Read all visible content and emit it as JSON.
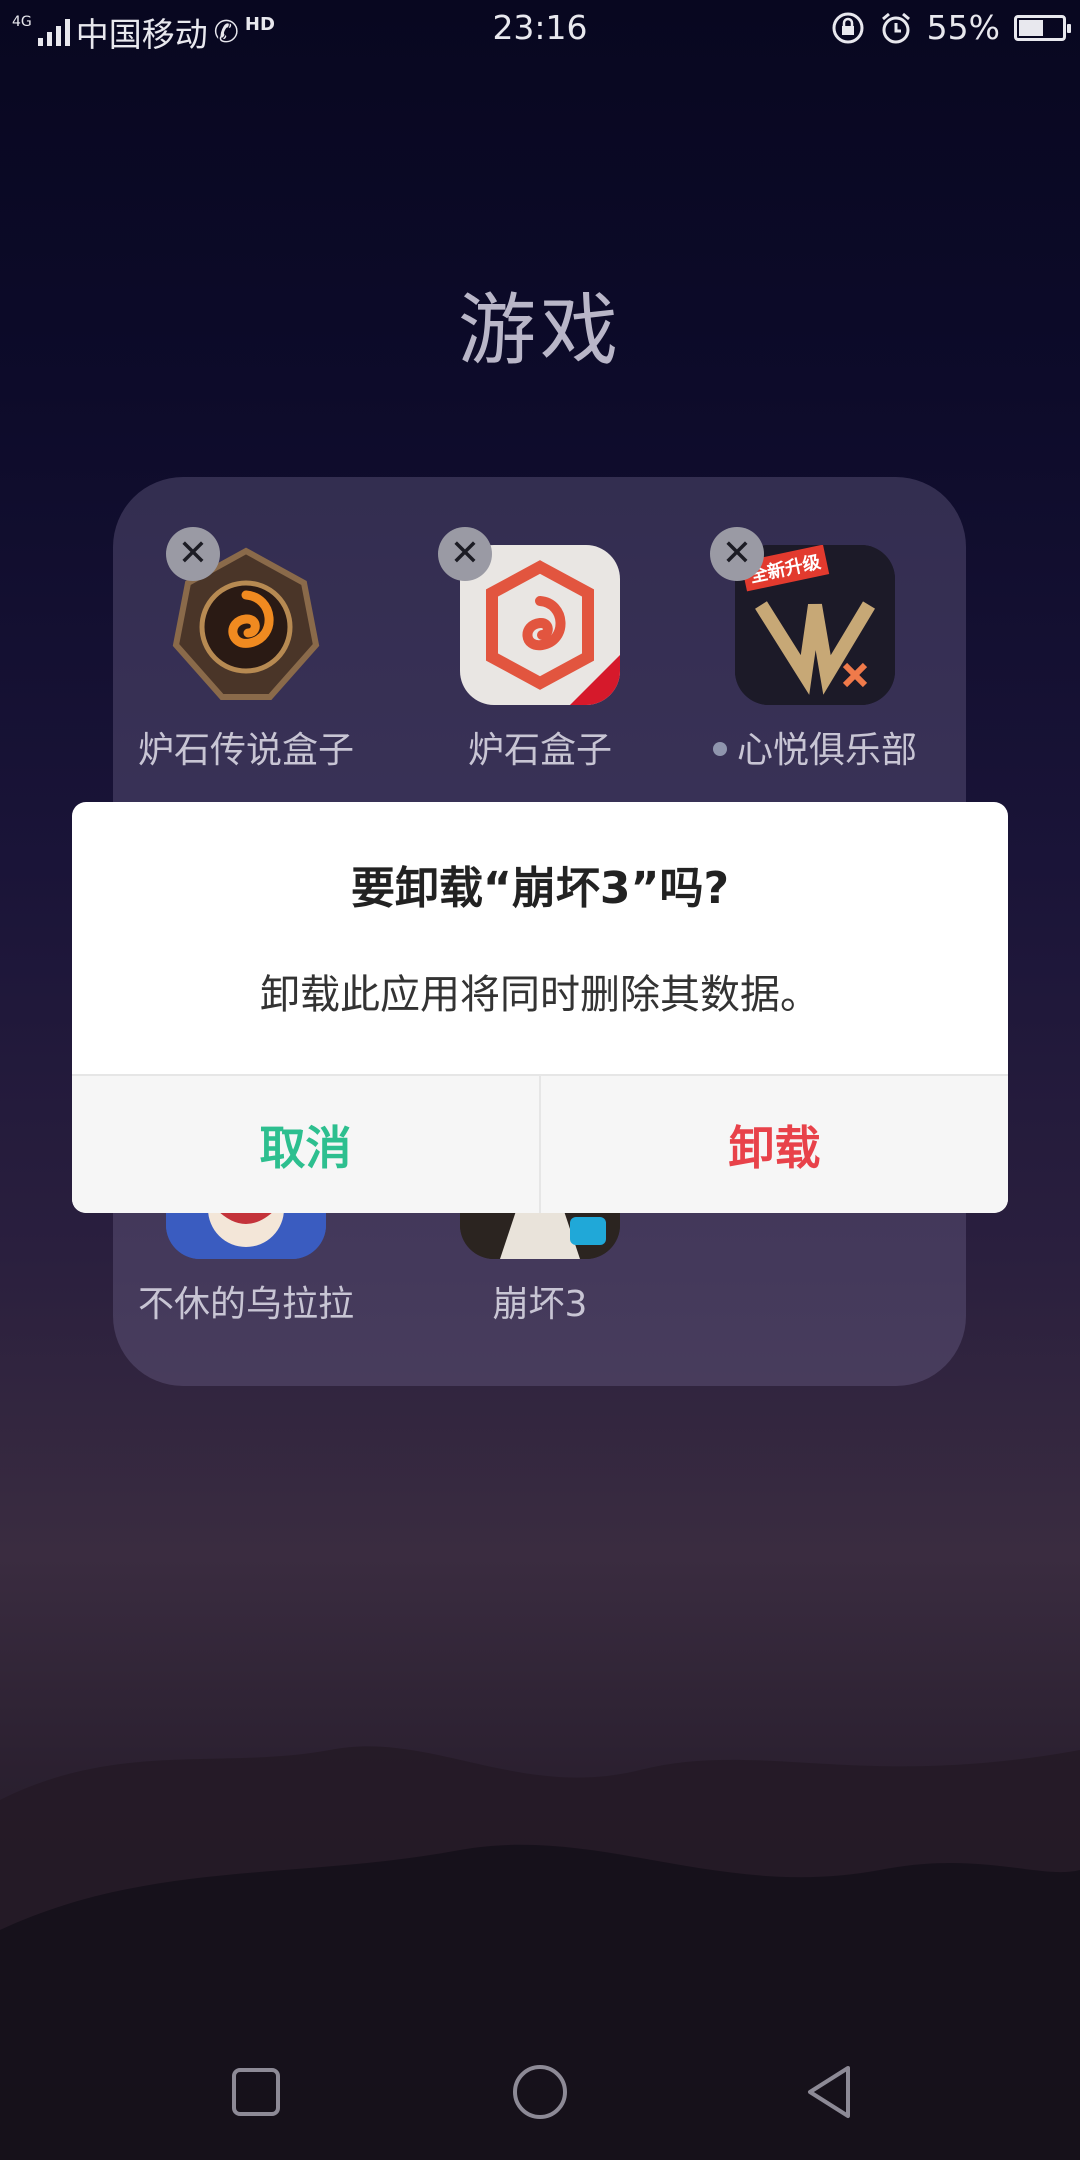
{
  "status_bar": {
    "network_type": "4G",
    "carrier": "中国移动",
    "hd_label": "HD",
    "time": "23:16",
    "battery_percent_text": "55%",
    "battery_level": 0.55,
    "icons": [
      "signal-icon",
      "call-hd-icon",
      "rotation-lock-icon",
      "alarm-icon",
      "battery-icon"
    ]
  },
  "folder": {
    "title": "游戏",
    "apps": [
      {
        "label": "炉石传说盒子",
        "icon": "hearthstone-box-icon",
        "removable": true
      },
      {
        "label": "炉石盒子",
        "icon": "hearthstone-netease-icon",
        "removable": true
      },
      {
        "label": "心悦俱乐部",
        "icon": "xinyue-club-icon",
        "removable": true,
        "has_dot": true
      },
      {
        "label": "不休的乌拉拉",
        "icon": "ulala-icon",
        "removable": true
      },
      {
        "label": "崩坏3",
        "icon": "honkai3-icon",
        "removable": true
      }
    ],
    "close_glyph": "✕",
    "vip_icon_text": "全新升级"
  },
  "dialog": {
    "title": "要卸载“崩坏3”吗?",
    "message": "卸载此应用将同时删除其数据。",
    "cancel_label": "取消",
    "confirm_label": "卸载",
    "colors": {
      "cancel": "#2dbf8f",
      "confirm": "#e8424a"
    }
  },
  "nav_bar": {
    "buttons": [
      "recents-icon",
      "home-icon",
      "back-icon"
    ]
  }
}
